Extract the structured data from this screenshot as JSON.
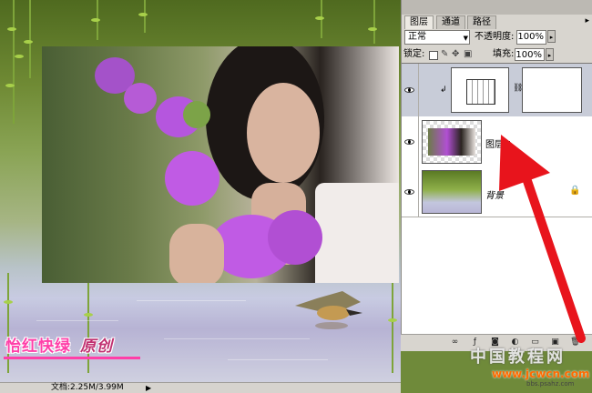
{
  "canvas": {
    "caption_main": "怡红快绿",
    "caption_original": "原创"
  },
  "status_bar": {
    "doc_info": "文档:2.25M/3.99M",
    "arrow": "▶"
  },
  "layers_panel": {
    "tabs": [
      {
        "label": "图层",
        "active": true
      },
      {
        "label": "通道",
        "active": false
      },
      {
        "label": "路径",
        "active": false
      }
    ],
    "menu_glyph": "▸",
    "blend_mode": "正常",
    "opacity_label": "不透明度:",
    "opacity_value": "100%",
    "lock_label": "锁定:",
    "fill_label": "填充:",
    "fill_value": "100%",
    "layers": [
      {
        "name": "",
        "type": "adjustment",
        "visible": true
      },
      {
        "name": "图层 1",
        "type": "image",
        "visible": true,
        "selected": false
      },
      {
        "name": "背景",
        "type": "background",
        "visible": true,
        "locked": true
      }
    ],
    "footer_icons": [
      "link-icon",
      "fx-icon",
      "mask-icon",
      "adjustment-icon",
      "folder-icon",
      "new-layer-icon",
      "trash-icon"
    ]
  },
  "watermark": {
    "line1": "中国教程网",
    "line2": "www.jcwcn.com",
    "line3": "bbs.psahz.com"
  },
  "colors": {
    "annotation_arrow": "#e8141c",
    "caption_pink": "#ff3fa8",
    "panel_bg": "#d8d5cf"
  }
}
